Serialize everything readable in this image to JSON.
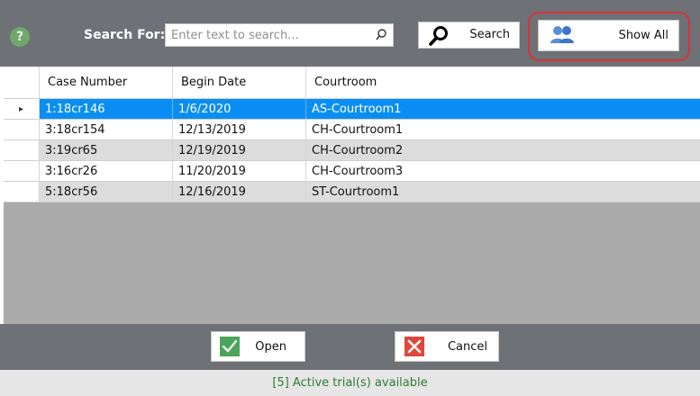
{
  "toolbar": {
    "help_glyph": "?",
    "search_label": "Search For:",
    "search_placeholder": "Enter text to search...",
    "search_value": "",
    "search_button_label": "Search",
    "show_all_label": "Show All"
  },
  "grid": {
    "columns": [
      "Case Number",
      "Begin Date",
      "Courtroom"
    ],
    "rows": [
      {
        "case_number": "1:18cr146",
        "begin_date": "1/6/2020",
        "courtroom": "AS-Courtroom1",
        "selected": true
      },
      {
        "case_number": "3:18cr154",
        "begin_date": "12/13/2019",
        "courtroom": "CH-Courtroom1",
        "selected": false
      },
      {
        "case_number": "3:19cr65",
        "begin_date": "12/19/2019",
        "courtroom": "CH-Courtroom2",
        "selected": false
      },
      {
        "case_number": "3:16cr26",
        "begin_date": "11/20/2019",
        "courtroom": "CH-Courtroom3",
        "selected": false
      },
      {
        "case_number": "5:18cr56",
        "begin_date": "12/16/2019",
        "courtroom": "ST-Courtroom1",
        "selected": false
      }
    ],
    "selected_row_indicator": "▸"
  },
  "footer": {
    "open_label": "Open",
    "cancel_label": "Cancel",
    "status_text": "[5] Active trial(s) available"
  },
  "colors": {
    "toolbar_bg": "#6e7176",
    "selection": "#0b8ef3",
    "status_text": "#2e7d32",
    "highlight_outline": "#d8323a",
    "open_icon": "#4aa55a",
    "cancel_icon": "#e0473a"
  },
  "icons": {
    "help": "help-icon",
    "search_inner": "magnifier-icon",
    "search_button": "magnifier-icon",
    "show_all": "users-icon",
    "open": "checkmark-icon",
    "cancel": "close-icon"
  }
}
